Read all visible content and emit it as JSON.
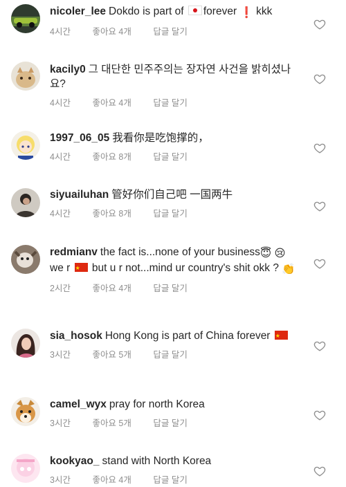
{
  "comments": [
    {
      "username": "nicoler_lee",
      "text": "Dokdo is part of",
      "text_after_flag": "forever",
      "text_end": "kkk",
      "time": "4시간",
      "likes": "좋아요 4개",
      "reply": "답글 달기"
    },
    {
      "username": "kacily0",
      "text": "그 대단한 민주주의는 장자연 사건을 밝히셨나요?",
      "time": "4시간",
      "likes": "좋아요 4개",
      "reply": "답글 달기"
    },
    {
      "username": "1997_06_05",
      "text": "我看你是吃饱撑的，",
      "time": "4시간",
      "likes": "좋아요 8개",
      "reply": "답글 달기"
    },
    {
      "username": "siyuailuhan",
      "text": "管好你们自己吧 一国两牛",
      "time": "4시간",
      "likes": "좋아요 8개",
      "reply": "답글 달기"
    },
    {
      "username": "redmianv",
      "text": "the fact is...none of your business",
      "text2": "we r",
      "text3": "but u r not...mind ur country's shit okk ?",
      "time": "2시간",
      "likes": "좋아요 4개",
      "reply": "답글 달기"
    },
    {
      "username": "sia_hosok",
      "text": "Hong Kong is part of China forever",
      "time": "3시간",
      "likes": "좋아요 5개",
      "reply": "답글 달기"
    },
    {
      "username": "camel_wyx",
      "text": "pray for north Korea",
      "time": "3시간",
      "likes": "좋아요 5개",
      "reply": "답글 달기"
    },
    {
      "username": "kookyao_",
      "text": "stand with North Korea",
      "time": "3시간",
      "likes": "좋아요 4개",
      "reply": "답글 달기"
    }
  ],
  "colors": {
    "text": "#262626",
    "meta": "#8e8e8e",
    "flag_red": "#de2910",
    "japan_red": "#d7141a"
  }
}
